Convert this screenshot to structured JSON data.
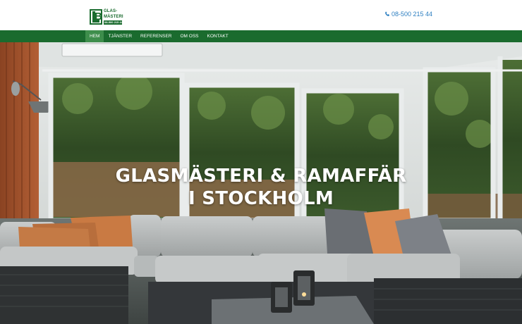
{
  "header": {
    "logo": {
      "line1": "GLAS-",
      "line2": "MÄSTERI",
      "phone_tag": "08-500 215 44"
    },
    "phone": "08-500 215 44"
  },
  "nav": {
    "items": [
      {
        "label": "HEM",
        "active": true
      },
      {
        "label": "TJÄNSTER",
        "active": false
      },
      {
        "label": "REFERENSER",
        "active": false
      },
      {
        "label": "OM OSS",
        "active": false
      },
      {
        "label": "KONTAKT",
        "active": false
      }
    ]
  },
  "hero": {
    "title_line1": "GLASMÄSTERI & RAMAFFÄR",
    "title_line2": "I STOCKHOLM"
  },
  "colors": {
    "brand_green": "#1a6b2e",
    "nav_active": "#3e8e4c",
    "phone_link": "#2d7fc1"
  }
}
